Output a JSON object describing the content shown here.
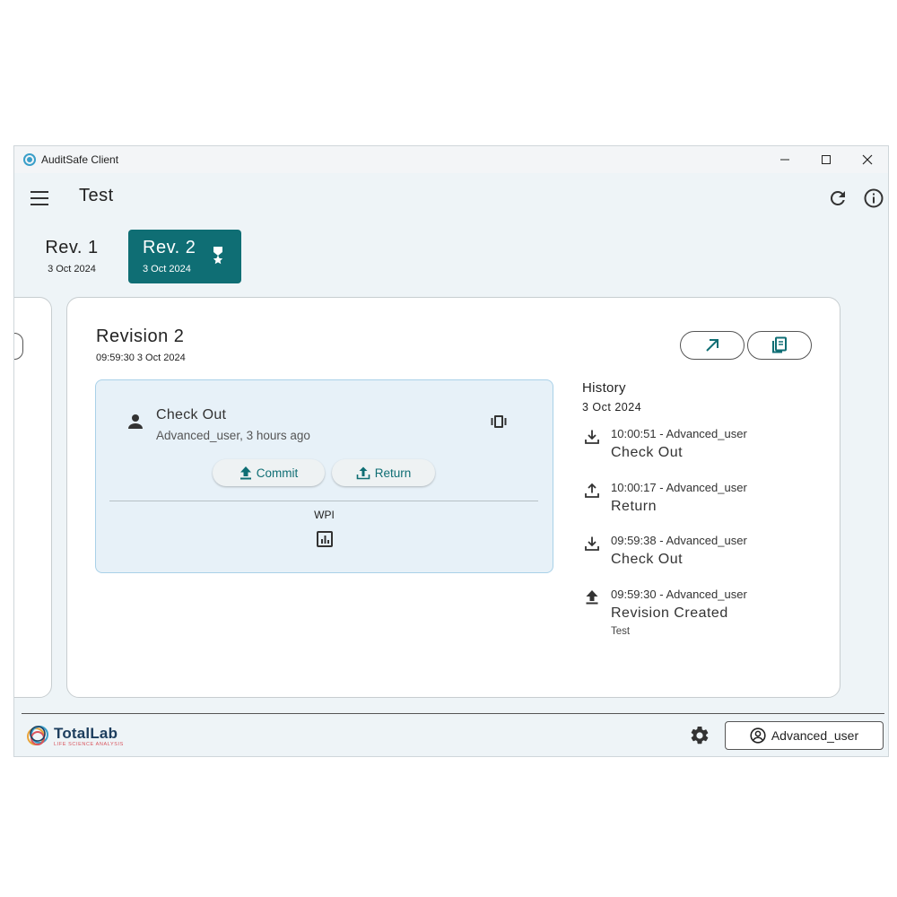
{
  "window": {
    "title": "AuditSafe Client",
    "controls": [
      "minimize",
      "maximize",
      "close"
    ]
  },
  "appbar": {
    "title": "Test",
    "icons": [
      "menu-icon",
      "refresh-icon",
      "info-icon"
    ]
  },
  "revisions": [
    {
      "name": "Rev. 1",
      "date": "3 Oct 2024",
      "selected": false
    },
    {
      "name": "Rev. 2",
      "date": "3 Oct 2024",
      "selected": true,
      "badge": "award-icon"
    }
  ],
  "card": {
    "title": "Revision 2",
    "subtitle": "09:59:30 3 Oct 2024",
    "actions": [
      "open-external-icon",
      "file-copy-icon"
    ]
  },
  "checkout": {
    "title": "Check Out",
    "subtitle": "Advanced_user, 3 hours ago",
    "commit_label": "Commit",
    "return_label": "Return",
    "wpi_label": "WPI"
  },
  "history": {
    "title": "History",
    "date": "3 Oct 2024",
    "items": [
      {
        "icon": "download-icon",
        "meta": "10:00:51 - Advanced_user",
        "action": "Check Out",
        "note": ""
      },
      {
        "icon": "upload-icon",
        "meta": "10:00:17 - Advanced_user",
        "action": "Return",
        "note": ""
      },
      {
        "icon": "download-icon",
        "meta": "09:59:38 - Advanced_user",
        "action": "Check Out",
        "note": ""
      },
      {
        "icon": "upload-filled-icon",
        "meta": "09:59:30 - Advanced_user",
        "action": "Revision Created",
        "note": "Test"
      }
    ]
  },
  "footer": {
    "logo_name": "TotalLab",
    "logo_tagline": "LIFE SCIENCE ANALYSIS",
    "user_label": "Advanced_user"
  },
  "colors": {
    "accent": "#0f6e74",
    "background": "#eef4f7",
    "checkout_bg": "#e7f1f8",
    "checkout_border": "#a9d1e8"
  }
}
